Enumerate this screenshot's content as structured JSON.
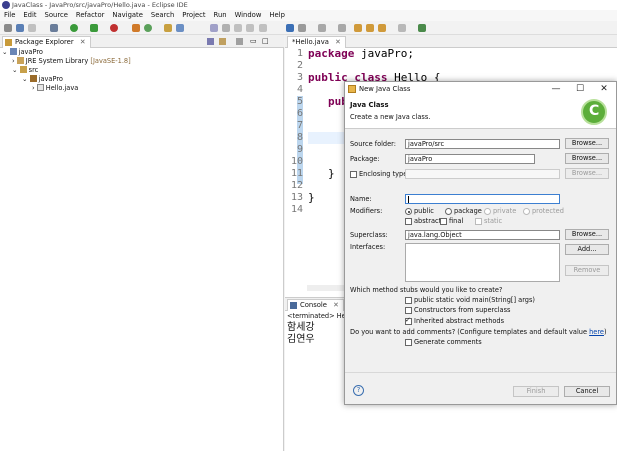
{
  "window": {
    "title": "JavaClass - JavaPro/src/javaPro/Hello.java - Eclipse IDE"
  },
  "menu": [
    "File",
    "Edit",
    "Source",
    "Refactor",
    "Navigate",
    "Search",
    "Project",
    "Run",
    "Window",
    "Help"
  ],
  "package_explorer": {
    "tab_label": "Package Explorer",
    "tree": {
      "project": "javaPro",
      "jre": "JRE System Library",
      "jre_version": "[JavaSE-1.8]",
      "src": "src",
      "package": "javaPro",
      "file": "Hello.java"
    }
  },
  "editor": {
    "tab_label": "*Hello.java",
    "line_numbers": [
      "1",
      "2",
      "3",
      "4",
      "5",
      "6",
      "7",
      "8",
      "9",
      "10",
      "11",
      "12",
      "13",
      "14"
    ],
    "lines": {
      "l1_kw": "package",
      "l1_rest": " javaPro;",
      "l3_kw": "public class",
      "l3_rest": " Hello {",
      "l5_kw": "pub",
      "l11": "}",
      "l13": "}"
    }
  },
  "console": {
    "tab_label": "Console",
    "status": "<terminated> Hello [",
    "output": [
      "함세강",
      "김연우"
    ]
  },
  "dialog": {
    "title": "New Java Class",
    "header_title": "Java Class",
    "header_desc": "Create a new Java class.",
    "source_folder_label": "Source folder:",
    "source_folder_value": "javaPro/src",
    "package_label": "Package:",
    "package_value": "javaPro",
    "enclosing_label": "Enclosing type:",
    "name_label": "Name:",
    "name_value": "",
    "modifiers_label": "Modifiers:",
    "mod_public": "public",
    "mod_package": "package",
    "mod_private": "private",
    "mod_protected": "protected",
    "mod_abstract": "abstract",
    "mod_final": "final",
    "mod_static": "static",
    "superclass_label": "Superclass:",
    "superclass_value": "java.lang.Object",
    "interfaces_label": "Interfaces:",
    "browse_label": "Browse...",
    "add_label": "Add...",
    "remove_label": "Remove",
    "stubs_question": "Which method stubs would you like to create?",
    "stub_main": "public static void main(String[] args)",
    "stub_ctors": "Constructors from superclass",
    "stub_inherited": "Inherited abstract methods",
    "comments_question": "Do you want to add comments? (Configure templates and default value ",
    "comments_link": "here",
    "comments_question_end": ")",
    "generate_comments": "Generate comments",
    "help_label": "?",
    "finish_label": "Finish",
    "cancel_label": "Cancel"
  },
  "colors": {
    "keyword": "#7f0055",
    "link": "#0645ad",
    "jre_note": "#8b6a3a"
  }
}
